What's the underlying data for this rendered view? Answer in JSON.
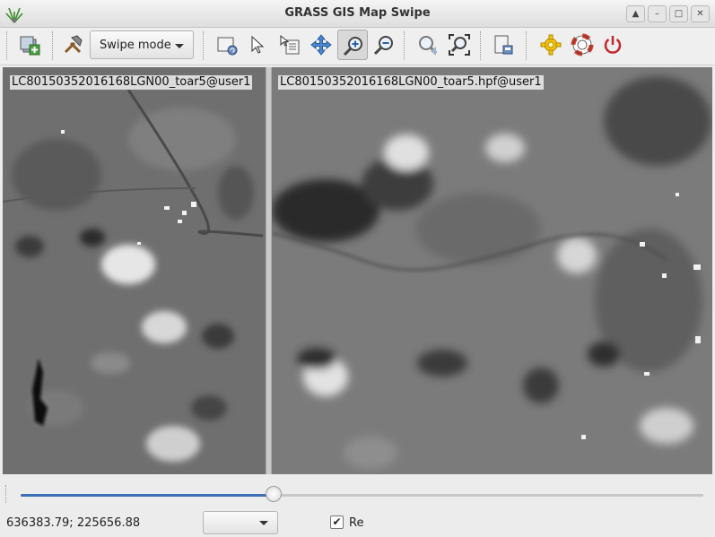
{
  "window": {
    "title": "GRASS GIS Map Swipe",
    "controls": [
      "up-arrow-icon",
      "minimize-icon",
      "maximize-icon",
      "close-icon"
    ]
  },
  "toolbar": {
    "tools": [
      {
        "name": "add-map-layer",
        "icon": "add-layers-icon"
      },
      {
        "name": "select-layers",
        "icon": "hammer-icon"
      },
      {
        "name": "render-display",
        "icon": "render-map-icon"
      },
      {
        "name": "pointer",
        "icon": "pointer-icon"
      },
      {
        "name": "query",
        "icon": "query-icon"
      },
      {
        "name": "pan",
        "icon": "pan-icon"
      },
      {
        "name": "zoom-in",
        "icon": "zoom-in-icon",
        "active": true
      },
      {
        "name": "zoom-out",
        "icon": "zoom-out-icon"
      },
      {
        "name": "zoom-back",
        "icon": "zoom-back-icon"
      },
      {
        "name": "zoom-extent",
        "icon": "zoom-extent-icon"
      },
      {
        "name": "export-map",
        "icon": "save-image-icon"
      },
      {
        "name": "preferences",
        "icon": "settings-gear-icon"
      },
      {
        "name": "help",
        "icon": "help-lifebuoy-icon"
      },
      {
        "name": "quit",
        "icon": "power-icon"
      }
    ],
    "swipe_mode_label": "Swipe mode"
  },
  "maps": {
    "left_layer": "LC80150352016168LGN00_toar5@user1",
    "right_layer": "LC80150352016168LGN00_toar5.hpf@user1"
  },
  "slider": {
    "value_fraction": 0.37
  },
  "status": {
    "coordinates": "636383.79; 225656.88",
    "combo_value": "",
    "render_checkbox_label": "Re",
    "render_checked": true
  },
  "colors": {
    "accent": "#3b6fb6",
    "quit": "#c0282a",
    "help": "#d23a2a",
    "gear": "#f2c40a"
  }
}
